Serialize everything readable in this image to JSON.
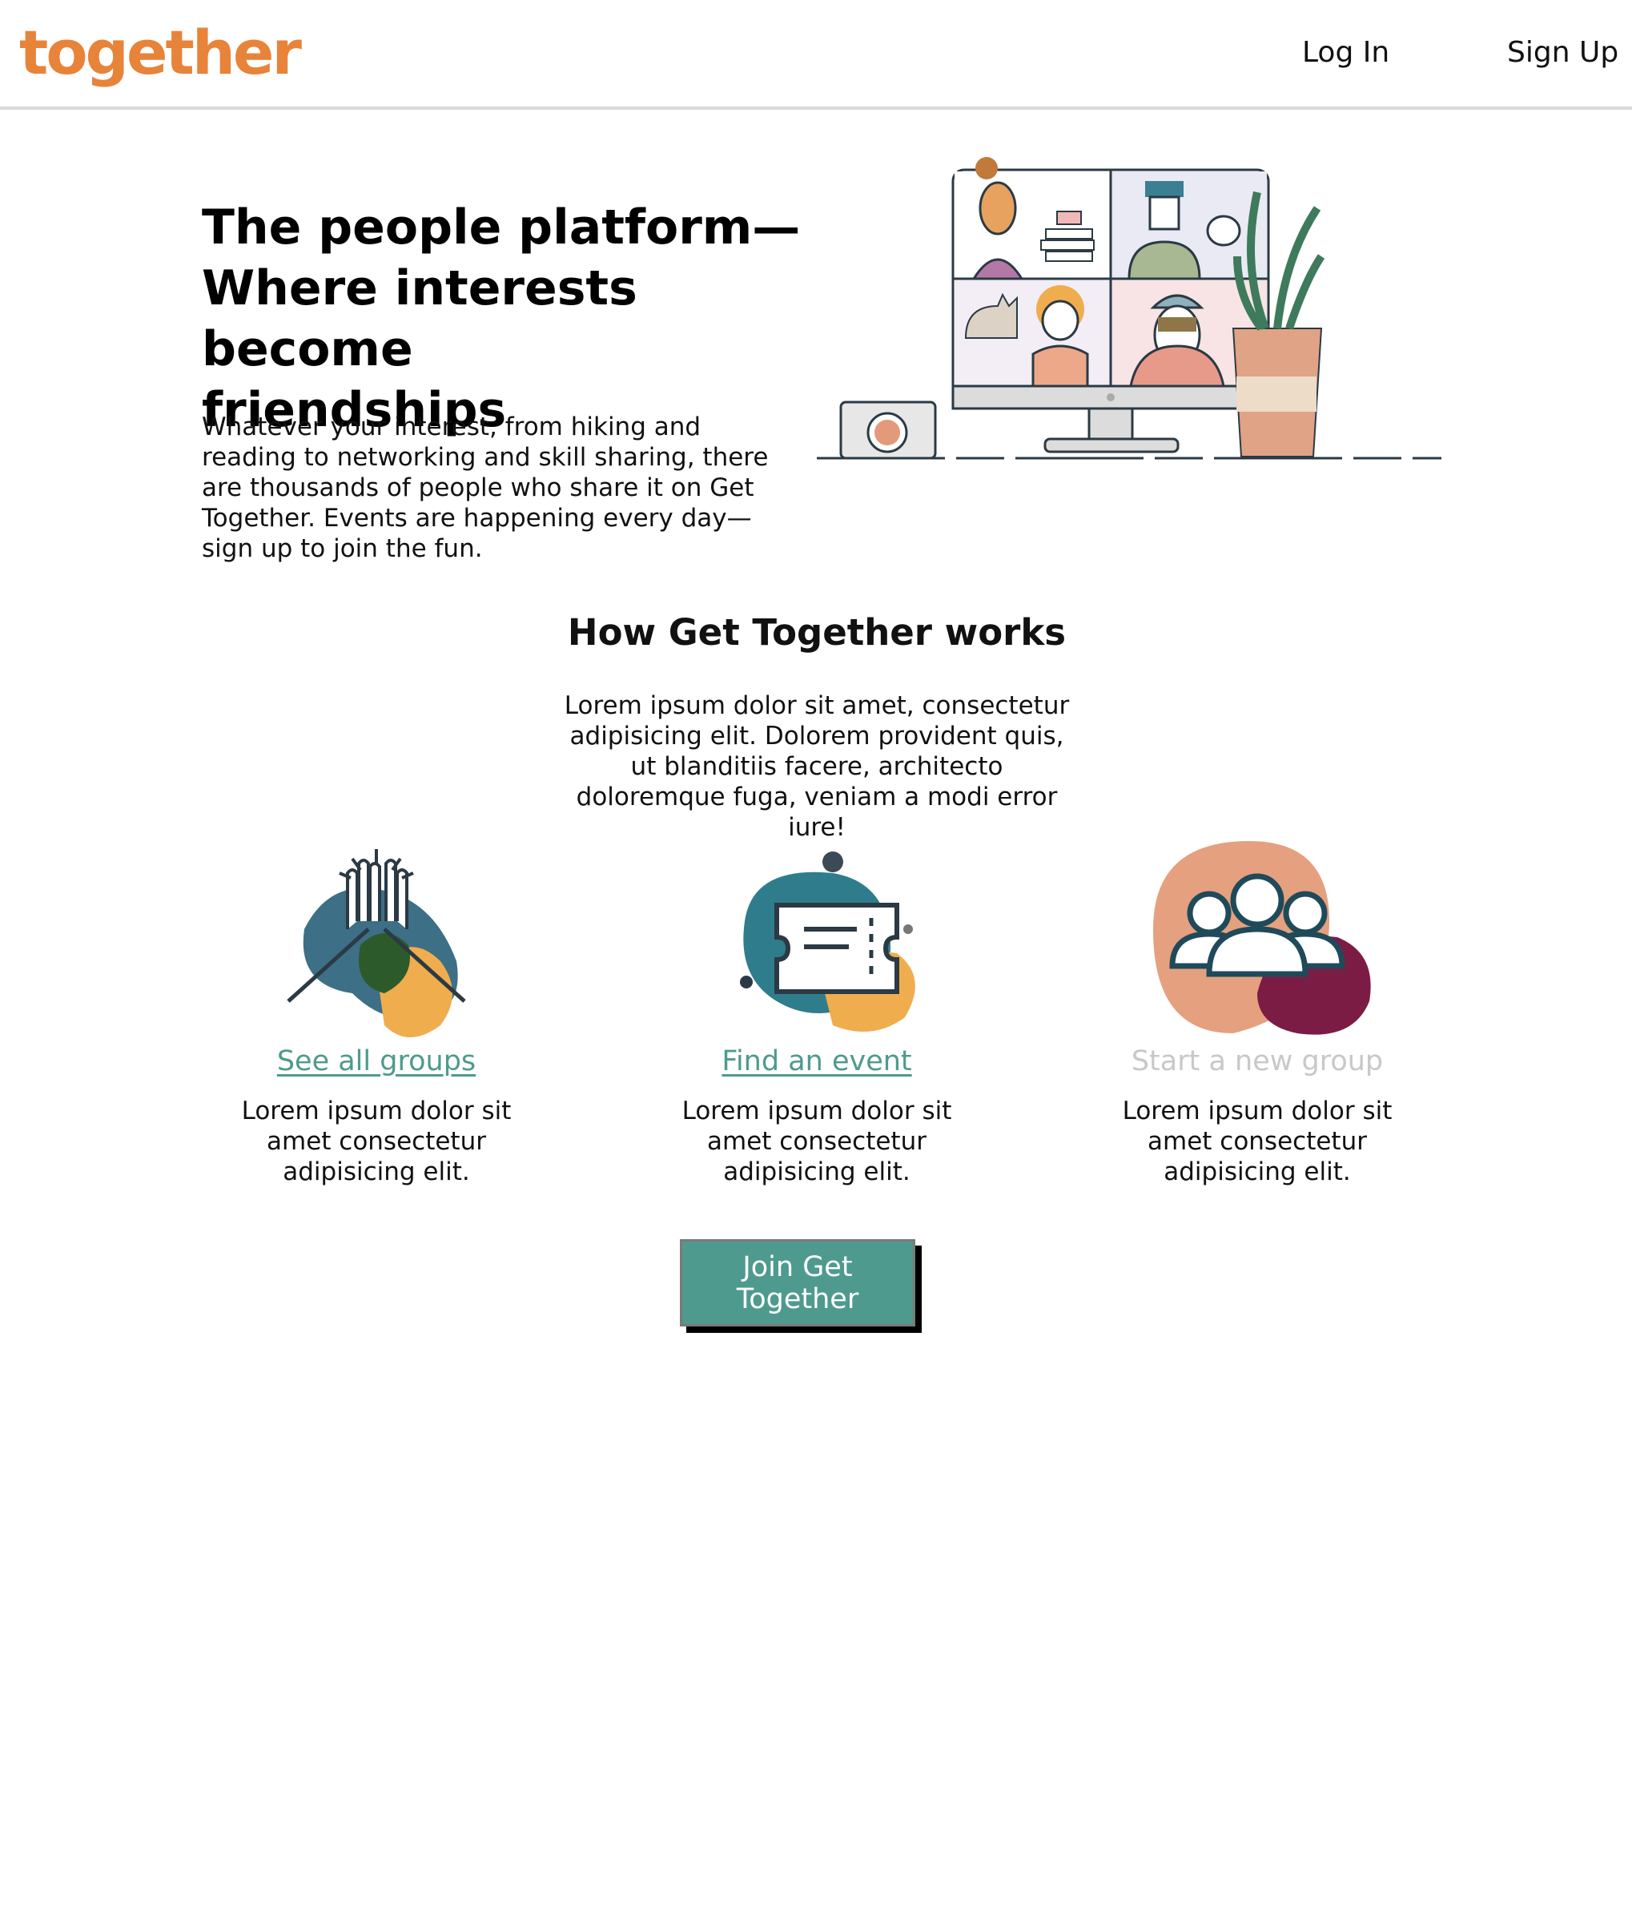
{
  "header": {
    "logo_text": "together",
    "logo_color": "#e8833a",
    "login_label": "Log In",
    "signup_label": "Sign Up"
  },
  "hero": {
    "title_line1": "The people platform—",
    "title_line2": "Where interests become",
    "title_line3": "friendships",
    "description": "Whatever your interest, from hiking and reading to networking and skill sharing, there are thousands of people who share it on Get Together. Events are happening every day—sign up to join the fun."
  },
  "how": {
    "title": "How Get Together works",
    "description": "Lorem ipsum dolor sit amet, consectetur adipisicing elit. Dolorem provident quis, ut blanditiis facere, architecto doloremque fuga, veniam a modi error iure!"
  },
  "features": [
    {
      "link": "See all groups",
      "description": "Lorem ipsum dolor sit amet consectetur adipisicing elit.",
      "icon": "high-five-icon"
    },
    {
      "link": "Find an event",
      "description": "Lorem ipsum dolor sit amet consectetur adipisicing elit.",
      "icon": "ticket-icon"
    },
    {
      "link": "Start a new group",
      "description": "Lorem ipsum dolor sit amet consectetur adipisicing elit.",
      "icon": "people-group-icon",
      "disabled": true
    }
  ],
  "cta": {
    "label": "Join Get Together"
  },
  "colors": {
    "accent": "#4e9a8e",
    "teal_dark": "#2f7d8c",
    "orange": "#f0ad4e",
    "salmon": "#e8a07f",
    "plum": "#7b1c45"
  }
}
